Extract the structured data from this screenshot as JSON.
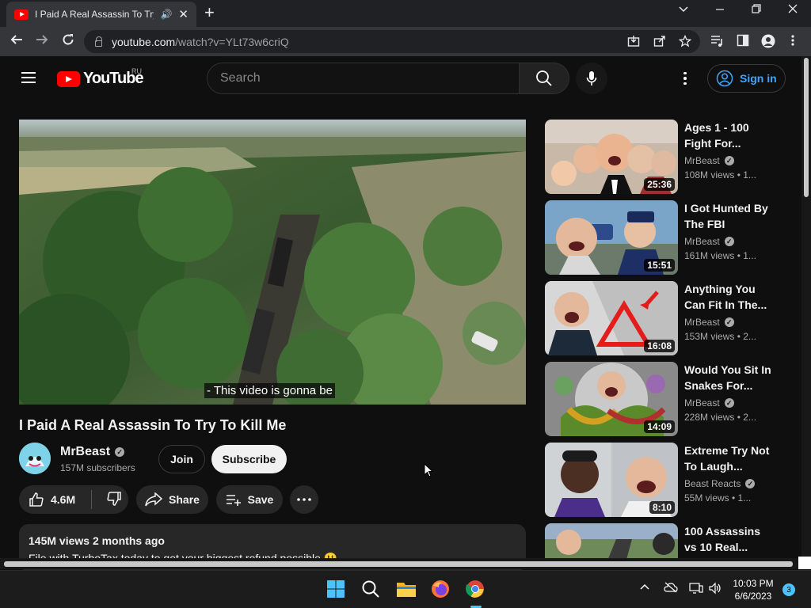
{
  "browser": {
    "tab_title": "I Paid A Real Assassin To Try",
    "url_host": "youtube.com",
    "url_path": "/watch?v=YLt73w6criQ"
  },
  "header": {
    "logo_text": "YouTube",
    "region": "RU",
    "search_placeholder": "Search",
    "signin_label": "Sign in"
  },
  "video": {
    "caption": "- This video is gonna be",
    "title": "I Paid A Real Assassin To Try To Kill Me",
    "channel": "MrBeast",
    "subscribers": "157M subscribers",
    "join_label": "Join",
    "subscribe_label": "Subscribe",
    "likes": "4.6M",
    "share_label": "Share",
    "save_label": "Save",
    "description_meta": "145M views  2 months ago",
    "description_text": "File with TurboTax today to get your biggest refund possible 😃"
  },
  "recommendations": [
    {
      "title": "Ages 1 - 100 Fight For...",
      "channel": "MrBeast",
      "meta": "108M views  • 1...",
      "duration": "25:36"
    },
    {
      "title": "I Got Hunted By The FBI",
      "channel": "MrBeast",
      "meta": "161M views  • 1...",
      "duration": "15:51"
    },
    {
      "title": "Anything You Can Fit In The...",
      "channel": "MrBeast",
      "meta": "153M views  • 2...",
      "duration": "16:08"
    },
    {
      "title": "Would You Sit In Snakes For...",
      "channel": "MrBeast",
      "meta": "228M views  • 2...",
      "duration": "14:09"
    },
    {
      "title": "Extreme Try Not To Laugh...",
      "channel": "Beast Reacts",
      "meta": "55M views  • 1...",
      "duration": "8:10"
    },
    {
      "title": "100 Assassins vs 10 Real...",
      "channel": "",
      "meta": "",
      "duration": ""
    }
  ],
  "taskbar": {
    "time": "10:03 PM",
    "date": "6/6/2023",
    "notifications": "3"
  },
  "colors": {
    "background": "#0f0f0f",
    "brand_red": "#ff0000",
    "link_blue": "#3ea6ff"
  }
}
